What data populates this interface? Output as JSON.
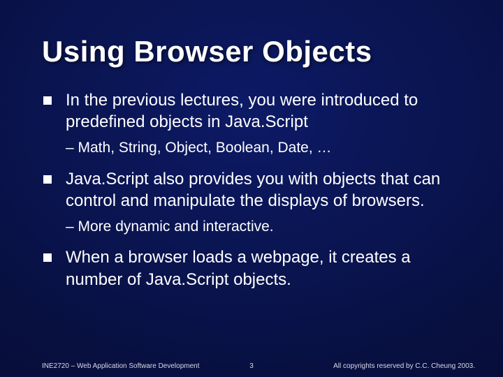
{
  "title": "Using Browser Objects",
  "bullets": [
    {
      "text": "In the previous lectures, you were introduced to predefined objects in Java.Script",
      "sub": "– Math, String, Object, Boolean, Date, …"
    },
    {
      "text": "Java.Script also provides you with objects that can control and manipulate the displays of browsers.",
      "sub": "– More dynamic and interactive."
    },
    {
      "text": "When a browser loads a webpage, it creates a number of Java.Script objects.",
      "sub": null
    }
  ],
  "footer": {
    "left": "INE2720 – Web Application Software Development",
    "center": "3",
    "right": "All copyrights reserved by C.C. Cheung 2003."
  }
}
